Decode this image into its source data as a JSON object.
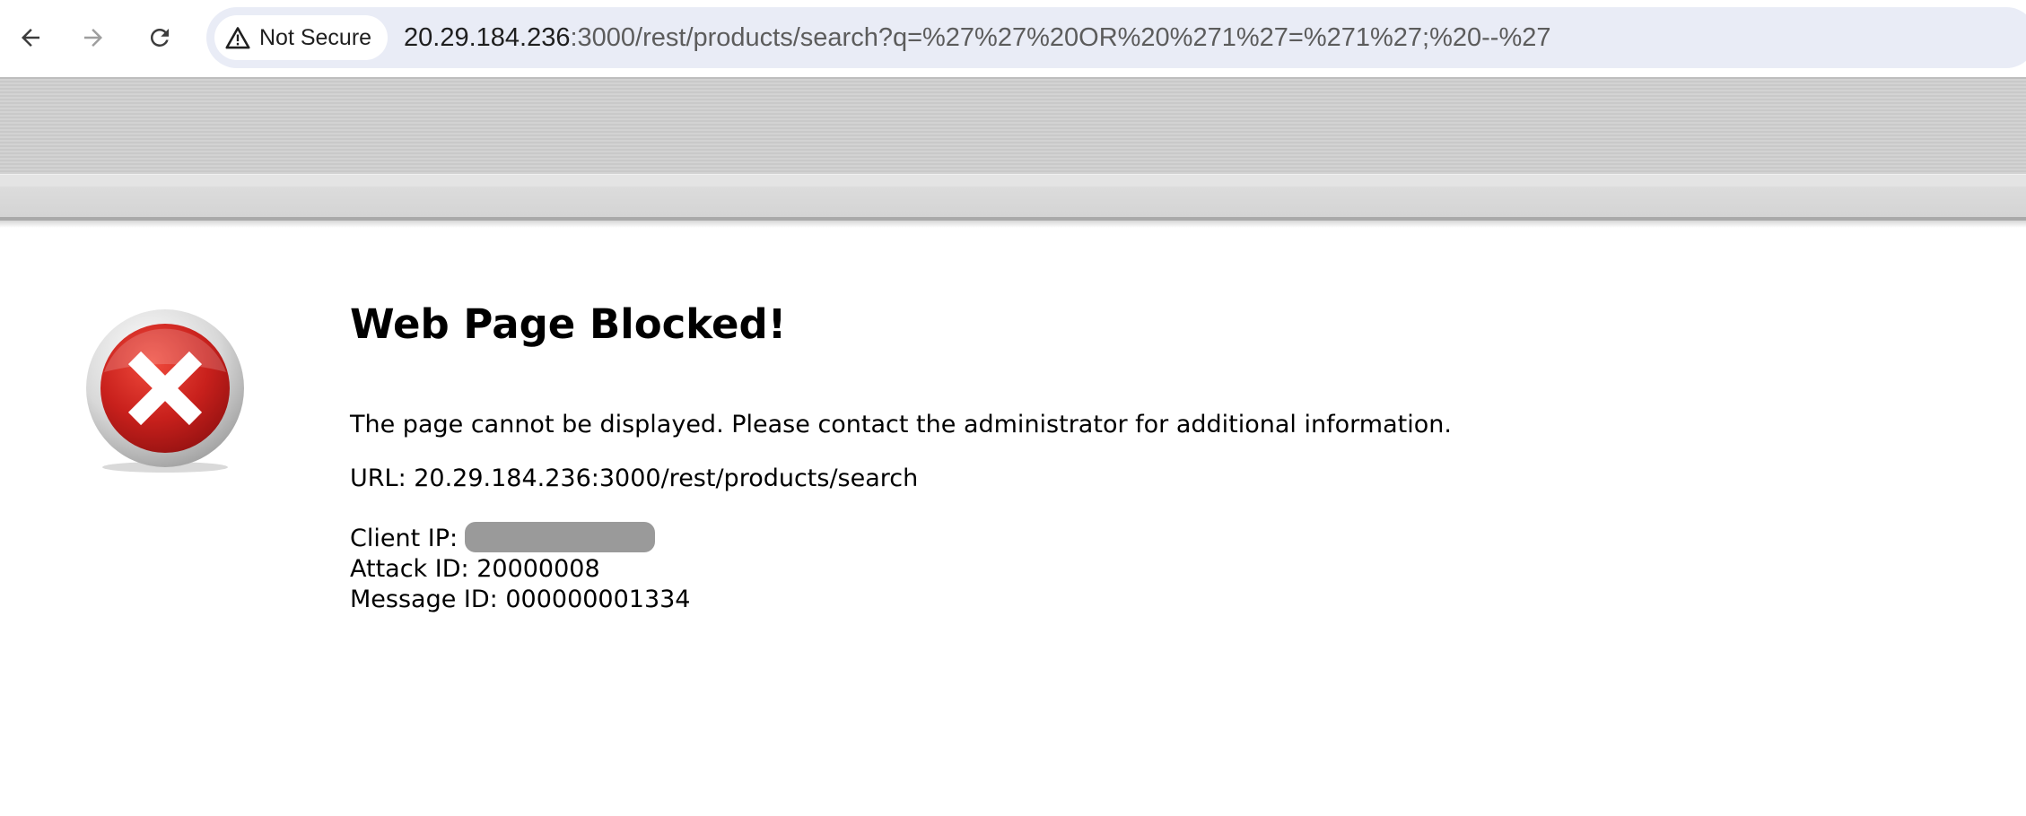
{
  "browser": {
    "back_icon": "arrow-left-icon",
    "forward_icon": "arrow-right-icon",
    "reload_icon": "reload-icon",
    "security_icon": "warning-triangle-icon",
    "security_label": "Not Secure",
    "url_host": "20.29.184.236",
    "url_rest": ":3000/rest/products/search?q=%27%27%20OR%20%271%27=%271%27;%20--%27"
  },
  "page": {
    "error_icon": "error-x-icon",
    "heading": "Web Page Blocked!",
    "message": "The page cannot be displayed. Please contact the administrator for additional information.",
    "url_line": "URL: 20.29.184.236:3000/rest/products/search",
    "client_ip_label": "Client IP:",
    "attack_id_line": "Attack ID: 20000008",
    "message_id_line": "Message ID: 000000001334"
  },
  "colors": {
    "omnibox_bg": "#e9ecf6",
    "error_red": "#c8201c",
    "banner_gray": "#cfcfcf"
  }
}
